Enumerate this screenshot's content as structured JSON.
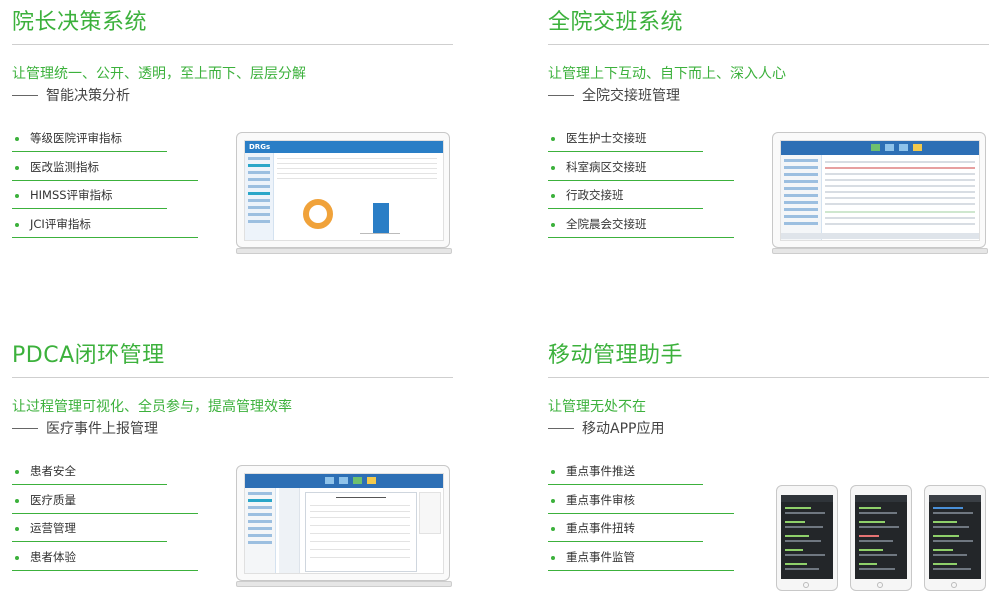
{
  "panels": [
    {
      "title": "院长决策系统",
      "tagline": "让管理统一、公开、透明，至上而下、层层分解",
      "subtitle": "智能决策分析",
      "features": [
        "等级医院评审指标",
        "医改监测指标",
        "HIMSS评审指标",
        "JCI评审指标"
      ],
      "screenshot_logo": "DRGs"
    },
    {
      "title": "全院交班系统",
      "tagline": "让管理上下互动、自下而上、深入人心",
      "subtitle": "全院交接班管理",
      "features": [
        "医生护士交接班",
        "科室病区交接班",
        "行政交接班",
        "全院晨会交接班"
      ]
    },
    {
      "title": "PDCA闭环管理",
      "tagline": "让过程管理可视化、全员参与，提高管理效率",
      "subtitle": "医疗事件上报管理",
      "features": [
        "患者安全",
        "医疗质量",
        "运营管理",
        "患者体验"
      ]
    },
    {
      "title": "移动管理助手",
      "tagline": "让管理无处不在",
      "subtitle": "移动APP应用",
      "features": [
        "重点事件推送",
        "重点事件审核",
        "重点事件扭转",
        "重点事件监管"
      ]
    }
  ],
  "colors": {
    "accent": "#3cb13c",
    "app_header": "#2a7ec6",
    "donut": "#f0a23a",
    "phone_screen": "#232629"
  }
}
